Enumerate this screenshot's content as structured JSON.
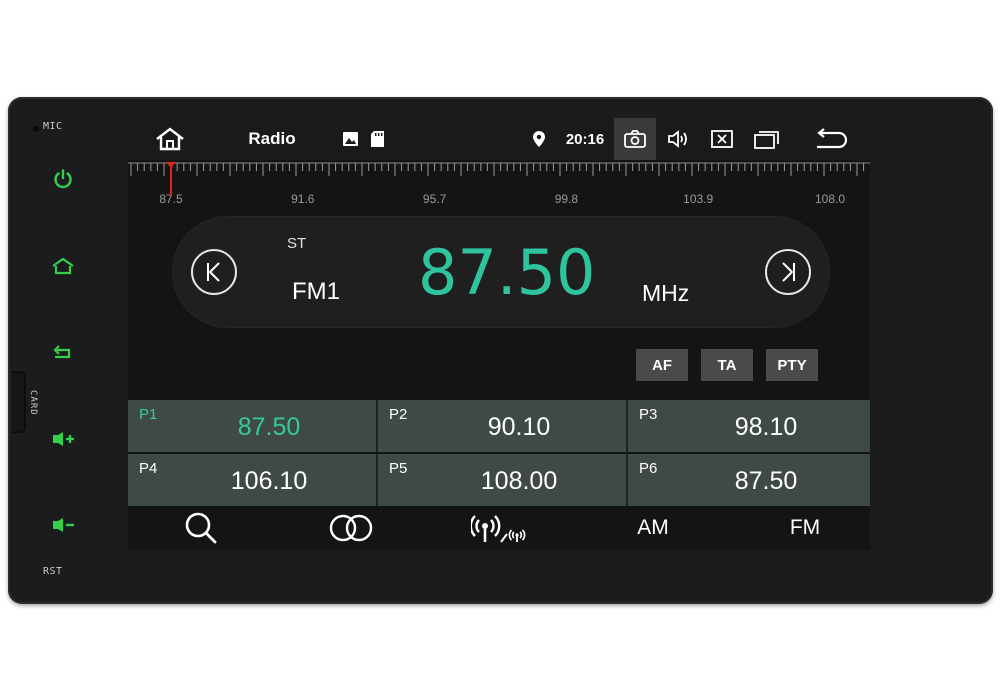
{
  "device": {
    "mic_label": "MIC",
    "card_label": "CARD",
    "rst_label": "RST",
    "hw_icon_color": "#35d04a"
  },
  "statusbar": {
    "title": "Radio",
    "time": "20:16",
    "icons": [
      "home-icon",
      "image-icon",
      "sd-card-icon",
      "location-icon",
      "camera-icon",
      "volume-icon",
      "close-window-icon",
      "recent-apps-icon",
      "back-icon"
    ]
  },
  "scale": {
    "labels": [
      "87.5",
      "91.6",
      "95.7",
      "99.8",
      "103.9",
      "108.0"
    ],
    "marker_value": 87.5
  },
  "tuner": {
    "stereo": "ST",
    "band": "FM1",
    "frequency": "87.50",
    "unit": "MHz",
    "accent_color": "#2fc49e"
  },
  "options": {
    "af": "AF",
    "ta": "TA",
    "pty": "PTY"
  },
  "presets": [
    {
      "label": "P1",
      "value": "87.50",
      "active": true
    },
    {
      "label": "P2",
      "value": "90.10",
      "active": false
    },
    {
      "label": "P3",
      "value": "98.10",
      "active": false
    },
    {
      "label": "P4",
      "value": "106.10",
      "active": false
    },
    {
      "label": "P5",
      "value": "108.00",
      "active": false
    },
    {
      "label": "P6",
      "value": "87.50",
      "active": false
    }
  ],
  "bottombar": {
    "am": "AM",
    "fm": "FM",
    "icons": [
      "search-icon",
      "stereo-icon",
      "broadcast-icon"
    ]
  }
}
